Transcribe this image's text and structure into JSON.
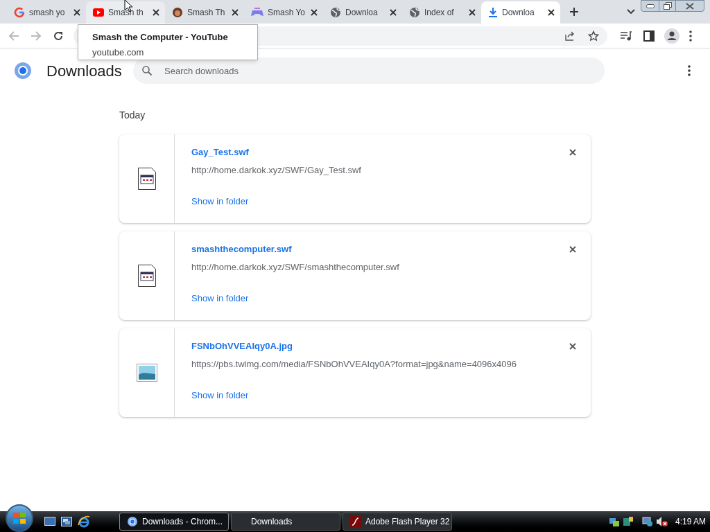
{
  "tabs": [
    {
      "title": "smash yo",
      "kind": "google",
      "selected": false,
      "hovered": false
    },
    {
      "title": "Smash th",
      "kind": "youtube",
      "selected": false,
      "hovered": true
    },
    {
      "title": "Smash Th",
      "kind": "avatar",
      "selected": false,
      "hovered": false
    },
    {
      "title": "Smash Yo",
      "kind": "gamepad",
      "selected": false,
      "hovered": false
    },
    {
      "title": "Downloa",
      "kind": "globe",
      "selected": false,
      "hovered": false
    },
    {
      "title": "Index of",
      "kind": "globe",
      "selected": false,
      "hovered": false
    },
    {
      "title": "Downloa",
      "kind": "download",
      "selected": true,
      "hovered": false
    }
  ],
  "tooltip": {
    "title": "Smash the Computer - YouTube",
    "subtitle": "youtube.com"
  },
  "page": {
    "title": "Downloads",
    "search": {
      "placeholder": "Search downloads"
    },
    "section": "Today"
  },
  "downloads": [
    {
      "name": "Gay_Test.swf",
      "url": "http://home.darkok.xyz/SWF/Gay_Test.swf",
      "action": "Show in folder",
      "kind": "file"
    },
    {
      "name": "smashthecomputer.swf",
      "url": "http://home.darkok.xyz/SWF/smashthecomputer.swf",
      "action": "Show in folder",
      "kind": "file"
    },
    {
      "name": "FSNbOhVVEAIqy0A.jpg",
      "url": "https://pbs.twimg.com/media/FSNbOhVVEAIqy0A?format=jpg&name=4096x4096",
      "action": "Show in folder",
      "kind": "image"
    }
  ],
  "taskbar": {
    "items": [
      {
        "label": "Downloads - Chrom...",
        "kind": "chrome",
        "selected": true
      },
      {
        "label": "Downloads",
        "kind": "plain",
        "selected": false
      },
      {
        "label": "Adobe Flash Player 32",
        "kind": "flash",
        "selected": false
      }
    ],
    "clock": "4:19 AM"
  }
}
